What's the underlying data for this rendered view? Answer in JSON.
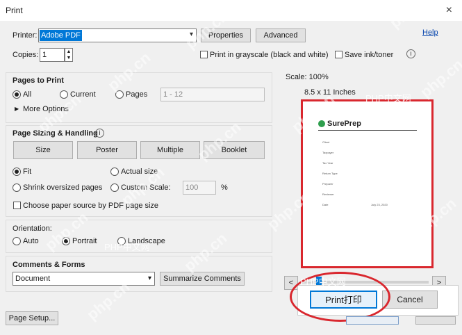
{
  "window": {
    "title": "Print",
    "close_glyph": "×"
  },
  "header": {
    "printer_label": "Printer:",
    "printer_value": "Adobe PDF",
    "properties_label": "Properties",
    "advanced_label": "Advanced",
    "help_label": "Help",
    "copies_label": "Copies:",
    "copies_value": "1",
    "grayscale_label": "Print in grayscale (black and white)",
    "save_ink_label": "Save ink/toner"
  },
  "pages": {
    "title": "Pages to Print",
    "all_label": "All",
    "current_label": "Current",
    "pages_label": "Pages",
    "range_value": "1 - 12",
    "more_options_label": "More Options"
  },
  "sizing": {
    "title": "Page Sizing & Handling",
    "tabs": [
      "Size",
      "Poster",
      "Multiple",
      "Booklet"
    ],
    "fit_label": "Fit",
    "actual_label": "Actual size",
    "shrink_label": "Shrink oversized pages",
    "custom_label": "Custom Scale:",
    "custom_value": "100",
    "percent": "%",
    "paper_source_label": "Choose paper source by PDF page size"
  },
  "orientation": {
    "title": "Orientation:",
    "auto_label": "Auto",
    "portrait_label": "Portrait",
    "landscape_label": "Landscape"
  },
  "comments": {
    "title": "Comments & Forms",
    "select_value": "Document",
    "summarize_label": "Summarize Comments"
  },
  "preview": {
    "scale_text": "Scale: 100%",
    "size_text": "8.5 x 11 Inches",
    "logo_text": "SurePrep",
    "fields": [
      {
        "k": "Client",
        "v": ""
      },
      {
        "k": "Taxpayer",
        "v": ""
      },
      {
        "k": "Tax Year",
        "v": ""
      },
      {
        "k": "Return Type",
        "v": ""
      },
      {
        "k": "Preparer",
        "v": ""
      },
      {
        "k": "Reviewer",
        "v": ""
      },
      {
        "k": "Date",
        "v": "July 23, 2020"
      }
    ],
    "next_glyph": ">",
    "prev_glyph": "<"
  },
  "footer": {
    "page_setup_label": "Page Setup...",
    "print_label": "Print打印",
    "cancel_label": "Cancel"
  },
  "watermarks": [
    "php.cn",
    "PHP中文网"
  ],
  "colors": {
    "highlight": "#0078d7",
    "annotation": "#d9272e",
    "link": "#0645ad"
  }
}
